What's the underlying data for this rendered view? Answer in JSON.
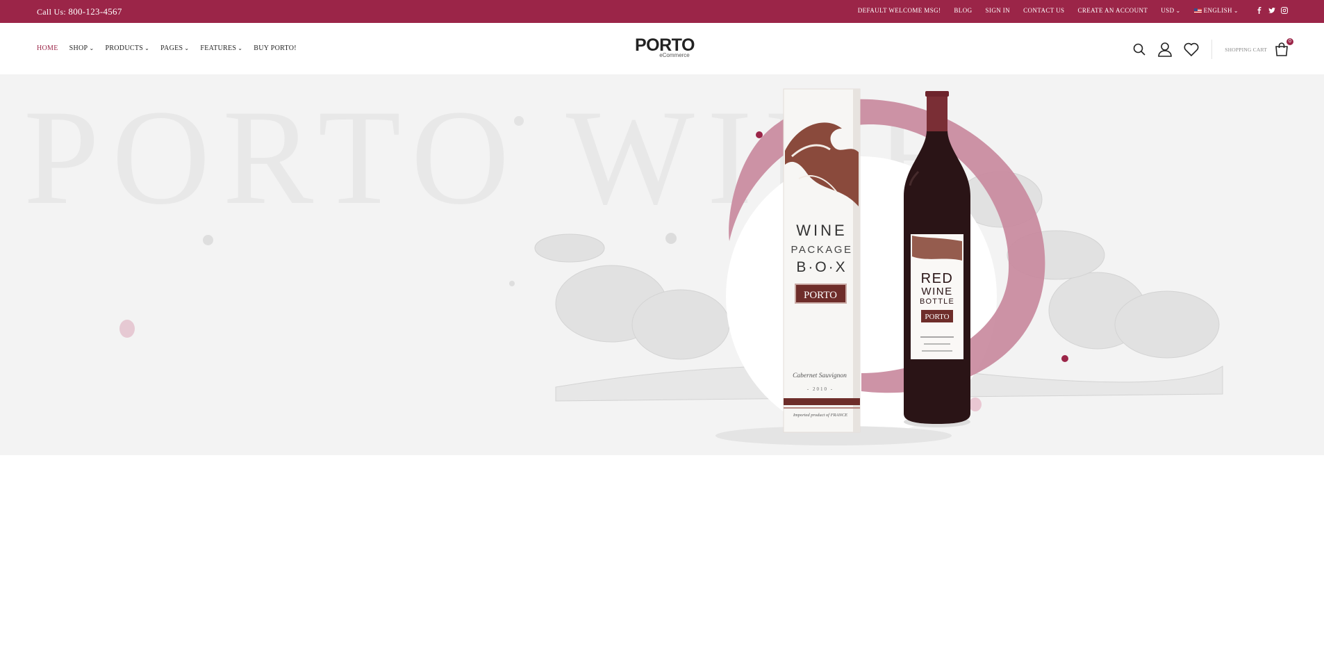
{
  "topbar": {
    "call_prefix": "Call Us:",
    "phone": "800-123-4567",
    "links": [
      "Default welcome msg!",
      "Blog",
      "Sign In",
      "Contact Us",
      "Create an Account"
    ],
    "currency": "USD",
    "language": "ENGLISH",
    "social_icons": [
      "facebook-icon",
      "twitter-icon",
      "instagram-icon"
    ]
  },
  "nav": {
    "home": "HOME",
    "shop": "SHOP",
    "products": "PRODUCTS",
    "pages": "PAGES",
    "features": "FEATURES",
    "buy": "BUY PORTO!"
  },
  "logo": {
    "word": "PORTO",
    "sub": "eCommerce"
  },
  "header": {
    "cart_label": "SHOPPING CART",
    "cart_count": "0"
  },
  "hero": {
    "bg_text": "PORTO WINE",
    "box": {
      "line1": "WINE",
      "line2": "PACKAGE",
      "line3": "B·O·X",
      "brand": "PORTO",
      "variety": "Cabernet Sauvignon",
      "year": "- 2010 -",
      "origin": "Imported product of  FRANCE"
    },
    "bottle": {
      "line1": "RED",
      "line2": "WINE",
      "line3": "BOTTLE",
      "brand": "PORTO"
    }
  },
  "colors": {
    "brand": "#9b2548",
    "hero_bg": "#f3f3f3",
    "ring": "#c98a9e"
  }
}
